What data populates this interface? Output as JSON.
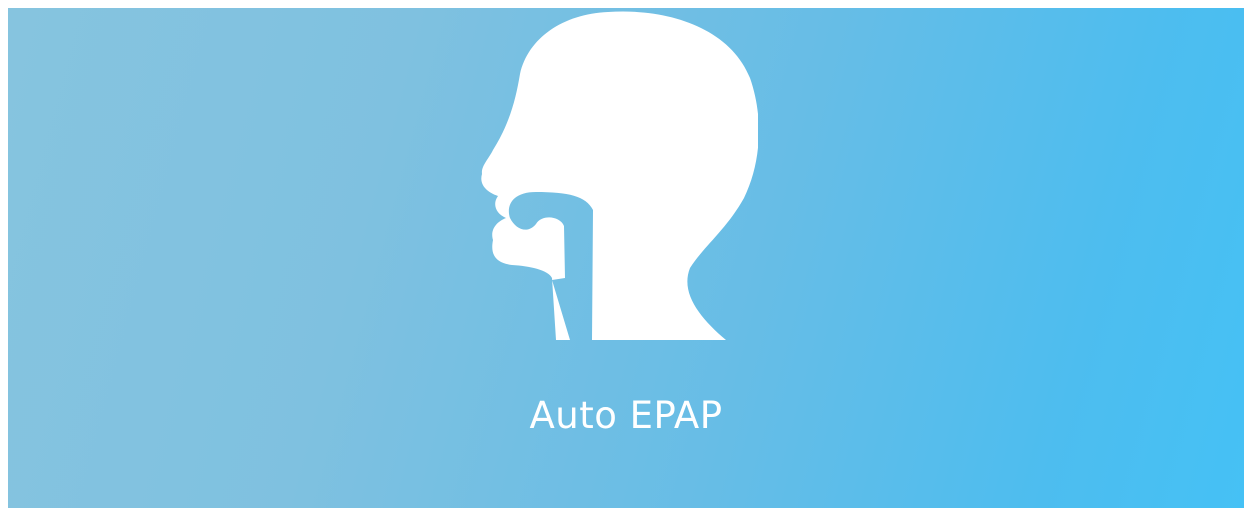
{
  "slide": {
    "caption": "Auto EPAP",
    "icon": "head-airway-profile-icon",
    "colors": {
      "background_start": "#86c4df",
      "background_end": "#45c1f5",
      "foreground": "#ffffff"
    }
  }
}
